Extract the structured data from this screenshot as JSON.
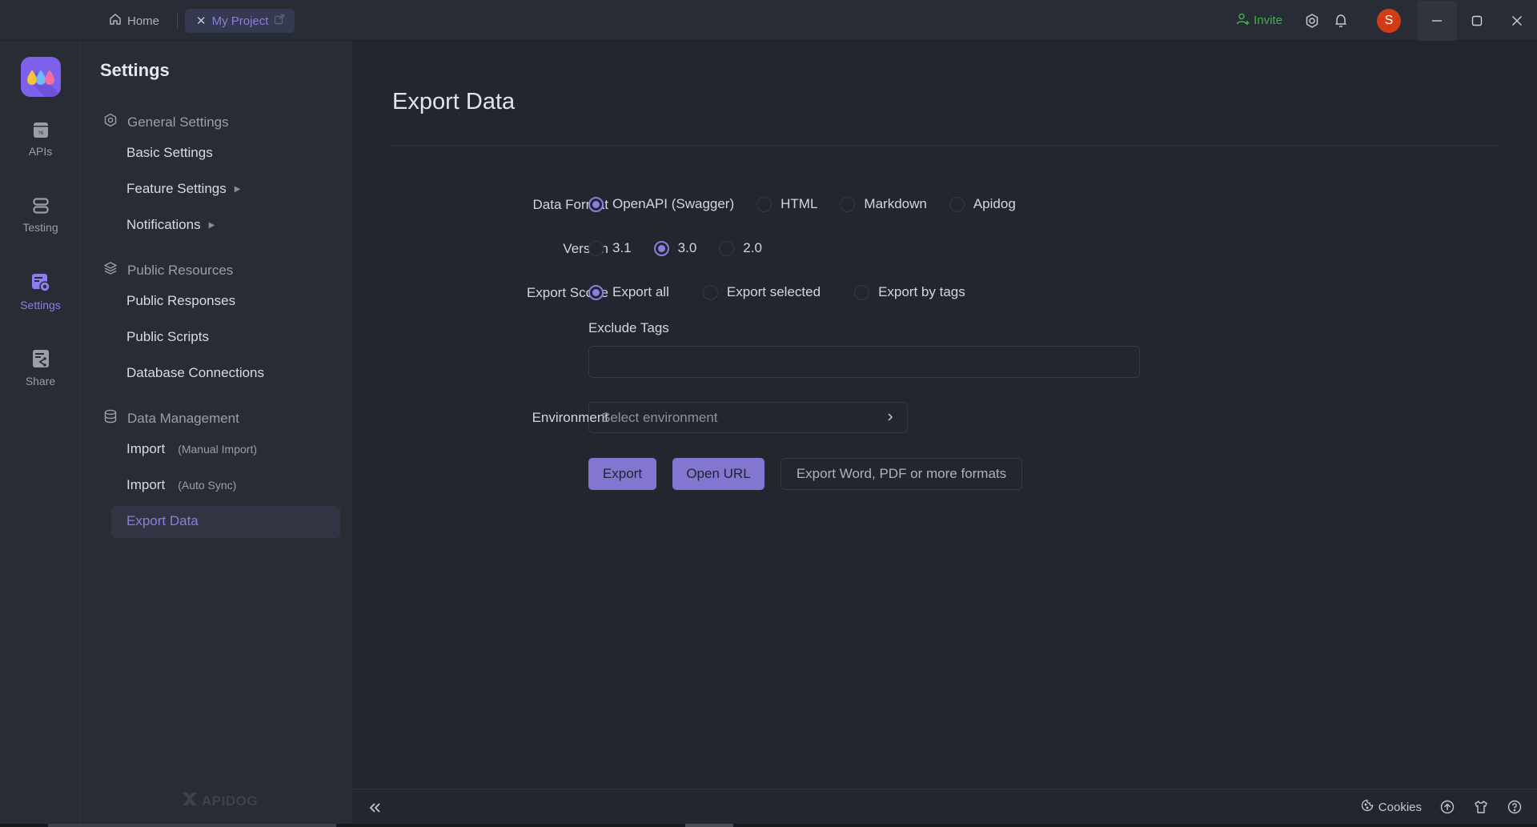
{
  "titlebar": {
    "home_tab": "Home",
    "project_tab": "My Project",
    "invite_label": "Invite",
    "avatar_initial": "S",
    "colors": {
      "invite": "#3fb24b",
      "avatar": "#d13c17",
      "accent": "#8a7fe0"
    }
  },
  "rail": {
    "items": [
      {
        "label": "APIs",
        "icon": "apis-icon",
        "active": false
      },
      {
        "label": "Testing",
        "icon": "testing-icon",
        "active": false
      },
      {
        "label": "Settings",
        "icon": "settings-icon",
        "active": true
      },
      {
        "label": "Share",
        "icon": "share-icon",
        "active": false
      }
    ]
  },
  "sidebar": {
    "title": "Settings",
    "groups": [
      {
        "label": "General Settings",
        "icon": "gear-icon",
        "items": [
          {
            "label": "Basic Settings"
          },
          {
            "label": "Feature Settings",
            "expandable": true
          },
          {
            "label": "Notifications",
            "expandable": true
          }
        ]
      },
      {
        "label": "Public Resources",
        "icon": "layers-icon",
        "items": [
          {
            "label": "Public Responses"
          },
          {
            "label": "Public Scripts"
          },
          {
            "label": "Database Connections"
          }
        ]
      },
      {
        "label": "Data Management",
        "icon": "database-icon",
        "items": [
          {
            "label": "Import",
            "sub": "(Manual Import)"
          },
          {
            "label": "Import",
            "sub": "(Auto Sync)"
          },
          {
            "label": "Export Data",
            "active": true
          }
        ]
      }
    ],
    "watermark": "APIDOG"
  },
  "main": {
    "title": "Export Data",
    "data_format": {
      "label": "Data Format",
      "options": [
        "OpenAPI (Swagger)",
        "HTML",
        "Markdown",
        "Apidog"
      ],
      "selected": "OpenAPI (Swagger)"
    },
    "version": {
      "label": "Version",
      "options": [
        "3.1",
        "3.0",
        "2.0"
      ],
      "selected": "3.0"
    },
    "export_scope": {
      "label": "Export Scope",
      "options": [
        "Export all",
        "Export selected",
        "Export by tags"
      ],
      "selected": "Export all"
    },
    "exclude_tags": {
      "label": "Exclude Tags",
      "value": ""
    },
    "environment": {
      "label": "Environment",
      "placeholder": "Select environment"
    },
    "buttons": {
      "export": "Export",
      "open_url": "Open URL",
      "more_formats": "Export Word, PDF or more formats"
    }
  },
  "bottombar": {
    "cookies_label": "Cookies"
  }
}
